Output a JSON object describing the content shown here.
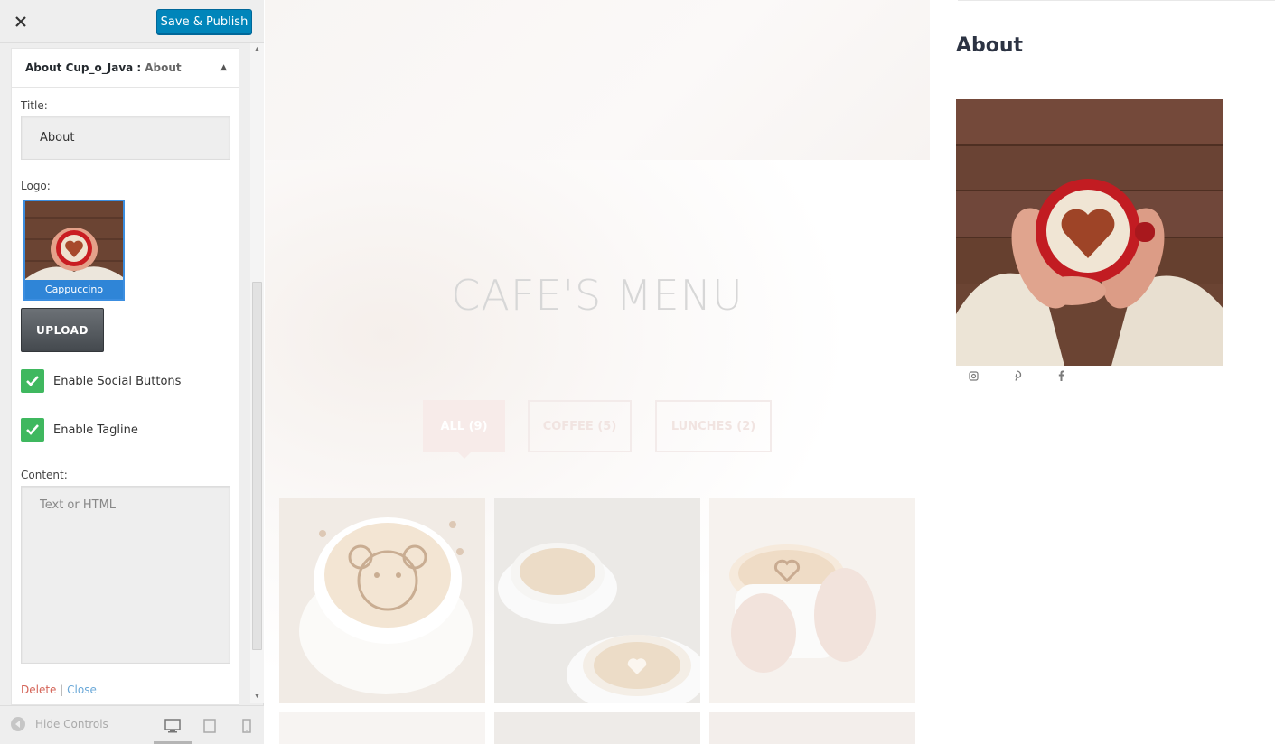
{
  "toolbar": {
    "close_icon": "close-icon",
    "publish_label": "Save & Publish"
  },
  "widget": {
    "title_prefix": "About Cup_o_Java :",
    "title_suffix": "About",
    "title_label": "Title:",
    "title_value": "About",
    "logo_label": "Logo:",
    "logo_caption": "Cappuccino",
    "upload_label": "UPLOAD",
    "social_label": "Enable Social Buttons",
    "tagline_label": "Enable Tagline",
    "content_label": "Content:",
    "content_placeholder": "Text or HTML",
    "delete_label": "Delete",
    "separator": "|",
    "close_label": "Close"
  },
  "footer": {
    "hide_label": "Hide Controls",
    "devices": [
      "desktop-icon",
      "tablet-icon",
      "mobile-icon"
    ]
  },
  "preview": {
    "menu_title": "CAFE'S MENU",
    "filters": [
      "ALL (9)",
      "COFFEE (5)",
      "LUNCHES (2)"
    ]
  },
  "sidebar_widget": {
    "title": "About",
    "social_icons": [
      "instagram-icon",
      "pinterest-icon",
      "facebook-icon"
    ]
  },
  "colors": {
    "publish": "#0085ba",
    "checkbox": "#3fb85f",
    "delete_link": "#d46357",
    "close_link": "#6aa8d8",
    "logo_selected": "#2f85d7"
  }
}
